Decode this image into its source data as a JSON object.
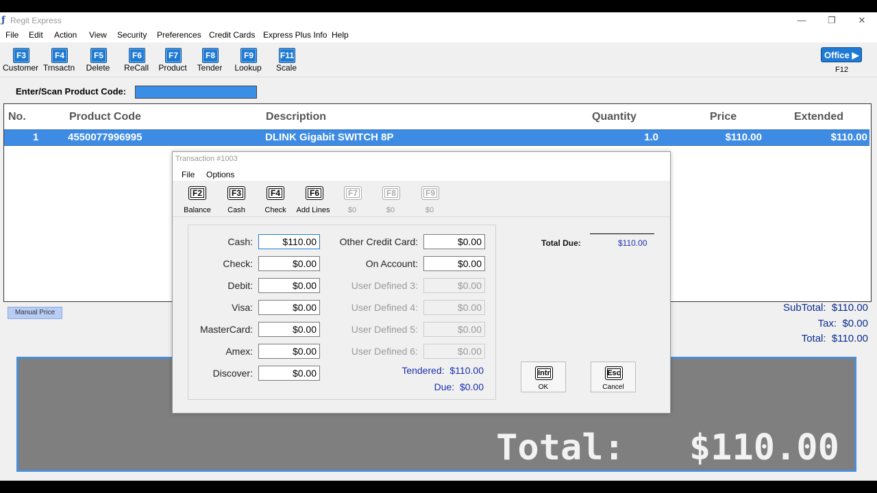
{
  "window": {
    "icon_glyph": "ƒ",
    "title": "Regit Express",
    "minimize_glyph": "—",
    "maximize_glyph": "❐",
    "close_glyph": "✕"
  },
  "menu": [
    "File",
    "Edit",
    "Action",
    "View",
    "Security",
    "Preferences",
    "Credit Cards",
    "Express Plus Info",
    "Help"
  ],
  "toolbar": [
    {
      "key": "F3",
      "label": "Customer"
    },
    {
      "key": "F4",
      "label": "Trnsactn"
    },
    {
      "key": "F5",
      "label": "Delete"
    },
    {
      "key": "F6",
      "label": "ReCall"
    },
    {
      "key": "F7",
      "label": "Product"
    },
    {
      "key": "F8",
      "label": "Tender"
    },
    {
      "key": "F9",
      "label": "Lookup"
    },
    {
      "key": "F11",
      "label": "Scale"
    }
  ],
  "office": {
    "label": "Office ▶",
    "key": "F12"
  },
  "scan": {
    "label": "Enter/Scan Product Code:",
    "value": ""
  },
  "grid": {
    "headers": [
      "No.",
      "Product Code",
      "Description",
      "Quantity",
      "Price",
      "Extended"
    ],
    "rows": [
      [
        "1",
        "4550077996995",
        "DLINK Gigabit SWITCH 8P",
        "1.0",
        "$110.00",
        "$110.00"
      ]
    ]
  },
  "manual_price_label": "Manual Price",
  "summary": [
    {
      "label": "SubTotal:",
      "value": "$110.00"
    },
    {
      "label": "Tax:",
      "value": "$0.00"
    },
    {
      "label": "Total:",
      "value": "$110.00"
    }
  ],
  "big_total": {
    "label": "Total:",
    "value": "$110.00"
  },
  "dialog": {
    "title": "Transaction #1003",
    "menu": [
      "File",
      "Options"
    ],
    "toolbar": [
      {
        "key": "F2",
        "label": "Balance",
        "enabled": true
      },
      {
        "key": "F3",
        "label": "Cash",
        "enabled": true
      },
      {
        "key": "F4",
        "label": "Check",
        "enabled": true
      },
      {
        "key": "F6",
        "label": "Add Lines",
        "enabled": true
      },
      {
        "key": "F7",
        "label": "$0",
        "enabled": false
      },
      {
        "key": "F8",
        "label": "$0",
        "enabled": false
      },
      {
        "key": "F9",
        "label": "$0",
        "enabled": false
      }
    ],
    "left_tenders": [
      {
        "label": "Cash:",
        "value": "$110.00"
      },
      {
        "label": "Check:",
        "value": "$0.00"
      },
      {
        "label": "Debit:",
        "value": "$0.00"
      },
      {
        "label": "Visa:",
        "value": "$0.00"
      },
      {
        "label": "MasterCard:",
        "value": "$0.00"
      },
      {
        "label": "Amex:",
        "value": "$0.00"
      },
      {
        "label": "Discover:",
        "value": "$0.00"
      }
    ],
    "right_tenders": [
      {
        "label": "Other Credit Card:",
        "value": "$0.00",
        "enabled": true
      },
      {
        "label": "On Account:",
        "value": "$0.00",
        "enabled": true
      },
      {
        "label": "User Defined 3:",
        "value": "$0.00",
        "enabled": false
      },
      {
        "label": "User Defined 4:",
        "value": "$0.00",
        "enabled": false
      },
      {
        "label": "User Defined 5:",
        "value": "$0.00",
        "enabled": false
      },
      {
        "label": "User Defined 6:",
        "value": "$0.00",
        "enabled": false
      }
    ],
    "tendered": {
      "label": "Tendered:",
      "value": "$110.00"
    },
    "due": {
      "label": "Due:",
      "value": "$0.00"
    },
    "total_due": {
      "label": "Total Due:",
      "value": "$110.00"
    },
    "ok": {
      "key": "Intr",
      "label": "OK"
    },
    "cancel": {
      "key": "Esc",
      "label": "Cancel"
    }
  }
}
